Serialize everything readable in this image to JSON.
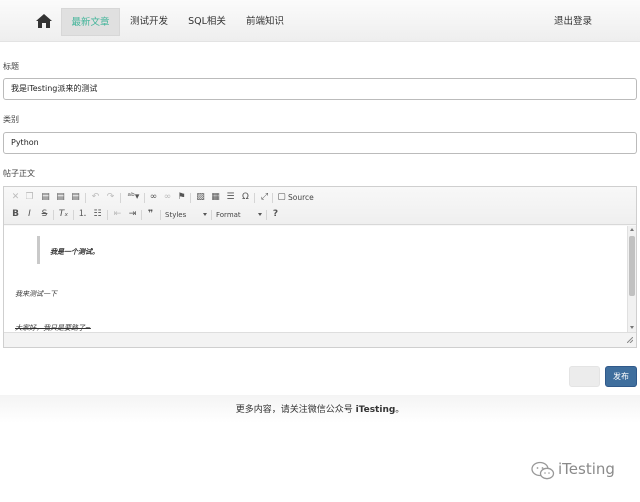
{
  "nav": {
    "items": [
      "最新文章",
      "测试开发",
      "SQL相关",
      "前端知识"
    ],
    "active_index": 0,
    "logout": "退出登录",
    "accent": "#43b59a"
  },
  "form": {
    "title_label": "标题",
    "title_value": "我是iTesting派来的测试",
    "category_label": "类别",
    "category_value": "Python",
    "body_label": "帖子正文"
  },
  "editor": {
    "toolbar": {
      "source_label": "Source",
      "styles_label": "Styles",
      "format_label": "Format",
      "help_label": "?"
    },
    "content": {
      "quote_line": "我是一个测试。",
      "line2": "我来测试一下",
      "line3": "大家好，我只是要路了~"
    }
  },
  "actions": {
    "publish_label": "发布",
    "publish_color": "#3f6e9d"
  },
  "footer": {
    "prefix": "更多内容，请关注微信公众号 ",
    "brand": "iTesting",
    "suffix": "。"
  },
  "watermark": {
    "text": "iTesting"
  }
}
